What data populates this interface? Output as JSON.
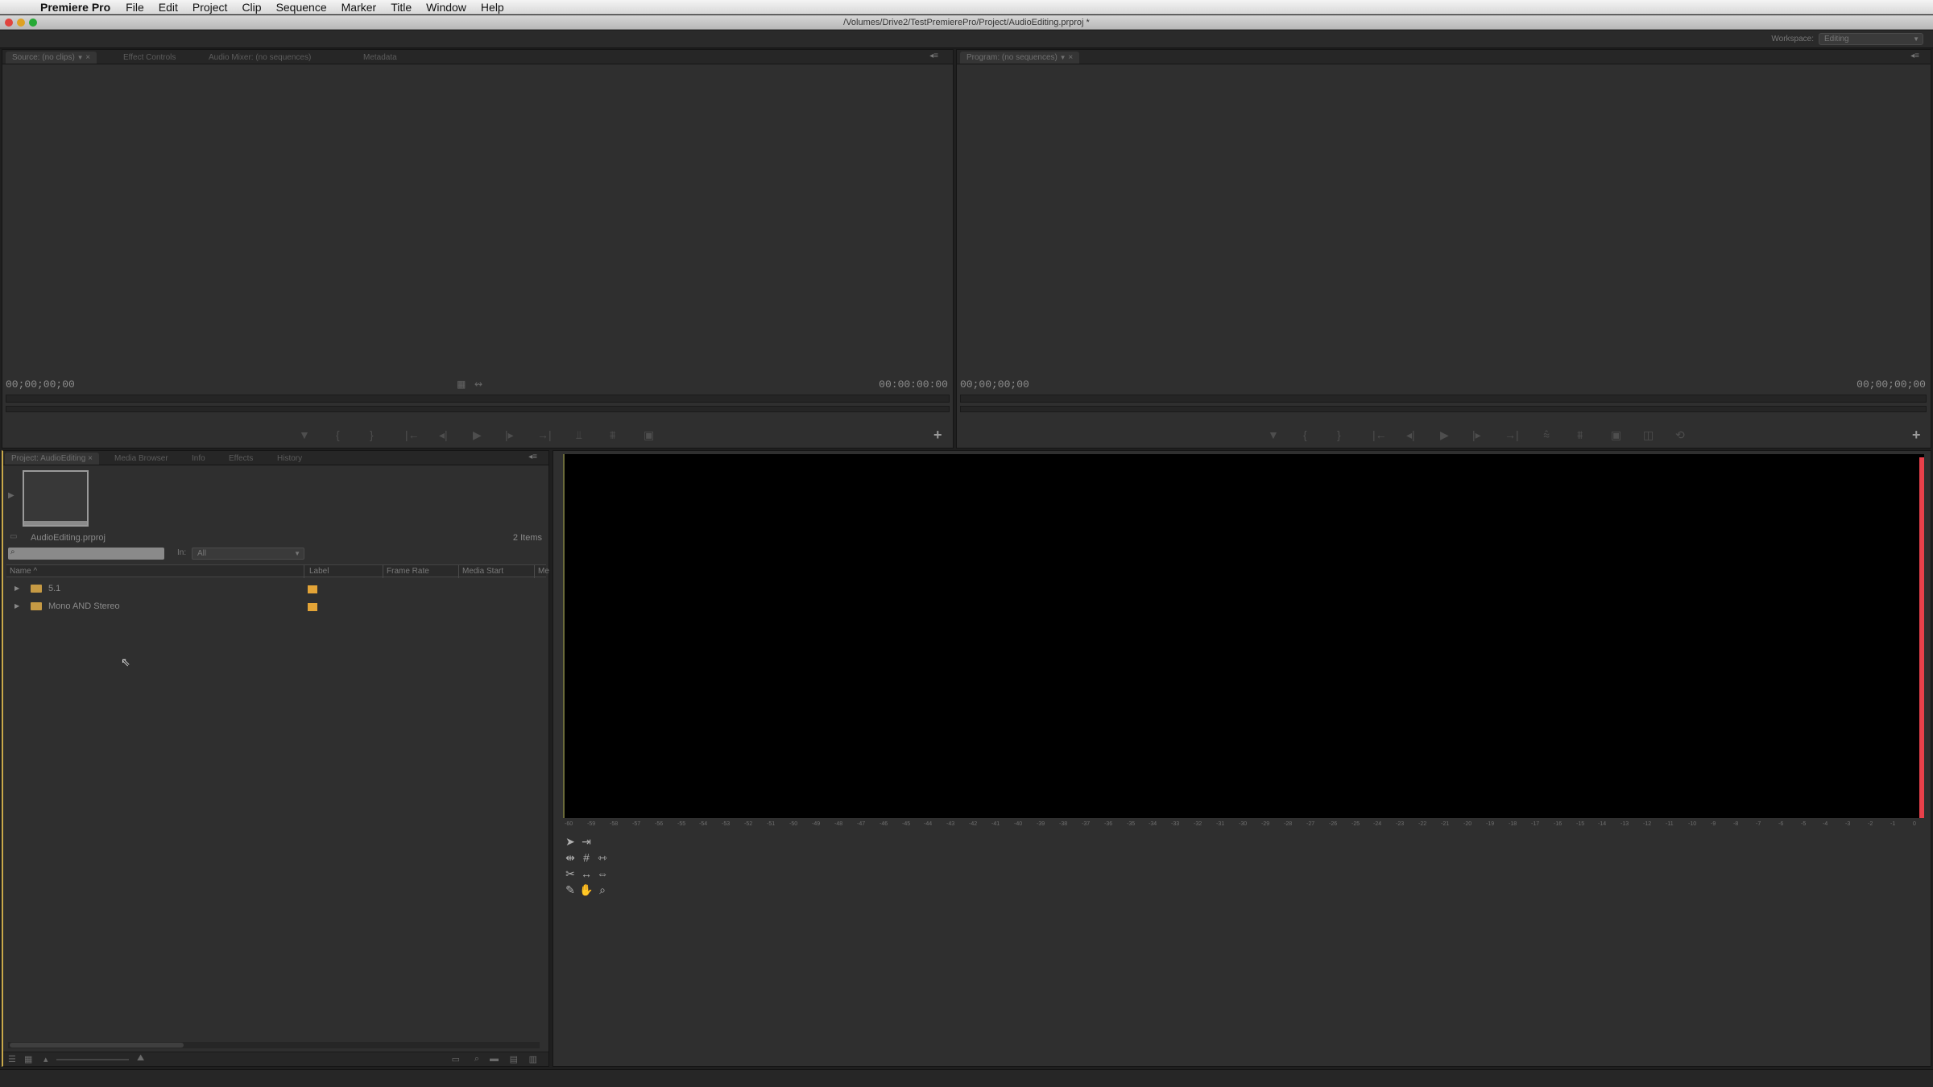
{
  "menu": {
    "apple_icon": "apple-icon",
    "app_name": "Premiere Pro",
    "items": [
      "File",
      "Edit",
      "Project",
      "Clip",
      "Sequence",
      "Marker",
      "Title",
      "Window",
      "Help"
    ]
  },
  "window": {
    "title": "/Volumes/Drive2/TestPremierePro/Project/AudioEditing.prproj *"
  },
  "workspace": {
    "label": "Workspace:",
    "selected": "Editing"
  },
  "source_monitor": {
    "tabs": [
      "Source: (no clips)",
      "Effect Controls",
      "Audio Mixer: (no sequences)",
      "Metadata"
    ],
    "timecode_left": "00;00;00;00",
    "timecode_right": "00:00:00:00"
  },
  "program_monitor": {
    "tabs": [
      "Program: (no sequences)"
    ],
    "timecode_left": "00;00;00;00",
    "timecode_right": "00;00;00;00"
  },
  "project": {
    "tabs": [
      "Project: AudioEditing",
      "Media Browser",
      "Info",
      "Effects",
      "History"
    ],
    "filename": "AudioEditing.prproj",
    "item_count": "2 Items",
    "search_placeholder": "",
    "in_label": "In:",
    "in_value": "All",
    "columns": [
      "Name",
      "Label",
      "Frame Rate",
      "Media Start",
      "Me"
    ],
    "rows": [
      {
        "name": "5.1",
        "label_color": "#e3a437"
      },
      {
        "name": "Mono AND Stereo",
        "label_color": "#e3a437"
      }
    ]
  },
  "audio_meter": {
    "ticks": [
      "-60",
      "-59",
      "-58",
      "-57",
      "-56",
      "-55",
      "-54",
      "-53",
      "-52",
      "-51",
      "-50",
      "-49",
      "-48",
      "-47",
      "-46",
      "-45",
      "-44",
      "-43",
      "-42",
      "-41",
      "-40",
      "-39",
      "-38",
      "-37",
      "-36",
      "-35",
      "-34",
      "-33",
      "-32",
      "-31",
      "-30",
      "-29",
      "-28",
      "-27",
      "-26",
      "-25",
      "-24",
      "-23",
      "-22",
      "-21",
      "-20",
      "-19",
      "-18",
      "-17",
      "-16",
      "-15",
      "-14",
      "-13",
      "-12",
      "-11",
      "-10",
      "-9",
      "-8",
      "-7",
      "-6",
      "-5",
      "-4",
      "-3",
      "-2",
      "-1",
      "0"
    ]
  },
  "colors": {
    "panel_bg": "#2f2f2f",
    "accent_orange": "#e3a437",
    "meter_red": "#e8404a"
  }
}
